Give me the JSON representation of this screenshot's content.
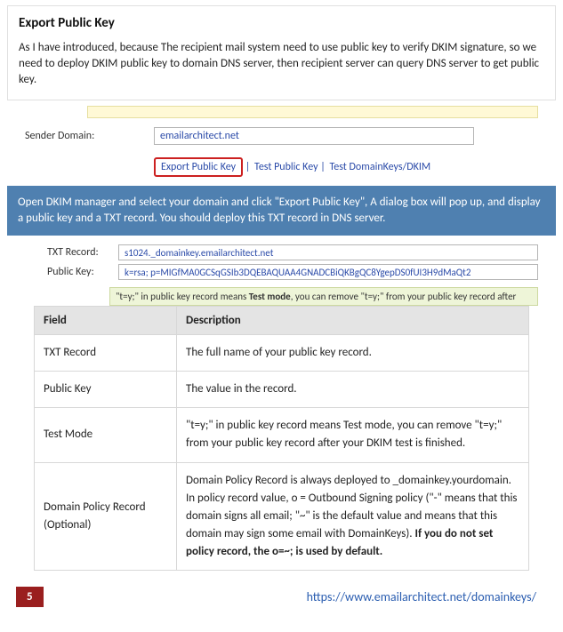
{
  "intro": {
    "heading": "Export Public Key",
    "text": "As I have introduced, because The recipient mail system need to use public key to verify DKIM signature, so we need to deploy DKIM public key to domain DNS server, then recipient server can query DNS server to get public key."
  },
  "form1": {
    "sender_domain_label": "Sender Domain:",
    "sender_domain_value": "emailarchitect.net",
    "export_link": "Export Public Key",
    "test_pk_link": "Test Public Key",
    "test_dk_link": "Test DomainKeys/DKIM"
  },
  "blue_note": "Open DKIM manager and select your domain and click \"Export Public Key\", A dialog box will pop up, and display a public key and a TXT record. You should deploy this TXT record in DNS server.",
  "form2": {
    "txt_record_label": "TXT Record:",
    "txt_record_value": "s1024._domainkey.emailarchitect.net",
    "public_key_label": "Public Key:",
    "public_key_value": "k=rsa; p=MIGfMA0GCSqGSIb3DQEBAQUAA4GNADCBiQKBgQC8YgepDS0fUI3H9dMaQt2"
  },
  "green_hint": {
    "prefix": "\"t=y;\" in public key record means ",
    "bold": "Test mode",
    "suffix": ", you can remove \"t=y;\" from your public key record after"
  },
  "table": {
    "head_field": "Field",
    "head_desc": "Description",
    "rows": [
      {
        "field": "TXT Record",
        "desc": "The full name of your public key record."
      },
      {
        "field": "Public Key",
        "desc": "The value in the record."
      },
      {
        "field": "Test Mode",
        "desc": "\"t=y;\" in public key record means Test mode, you can remove \"t=y;\" from your public key record after your DKIM test is finished."
      }
    ],
    "policy_field": "Domain Policy Record (Optional)",
    "policy_desc_pre": "Domain Policy Record is always deployed to _domainkey.yourdomain. In policy record value, o = Outbound Signing policy (\"-\" means that this domain signs all email; \"~\" is the default value and means that this domain may sign some email with DomainKeys). ",
    "policy_desc_bold": "If you do not set policy record, the o=~; is used by default."
  },
  "footer": {
    "page_number": "5",
    "url": "https://www.emailarchitect.net/domainkeys/"
  }
}
